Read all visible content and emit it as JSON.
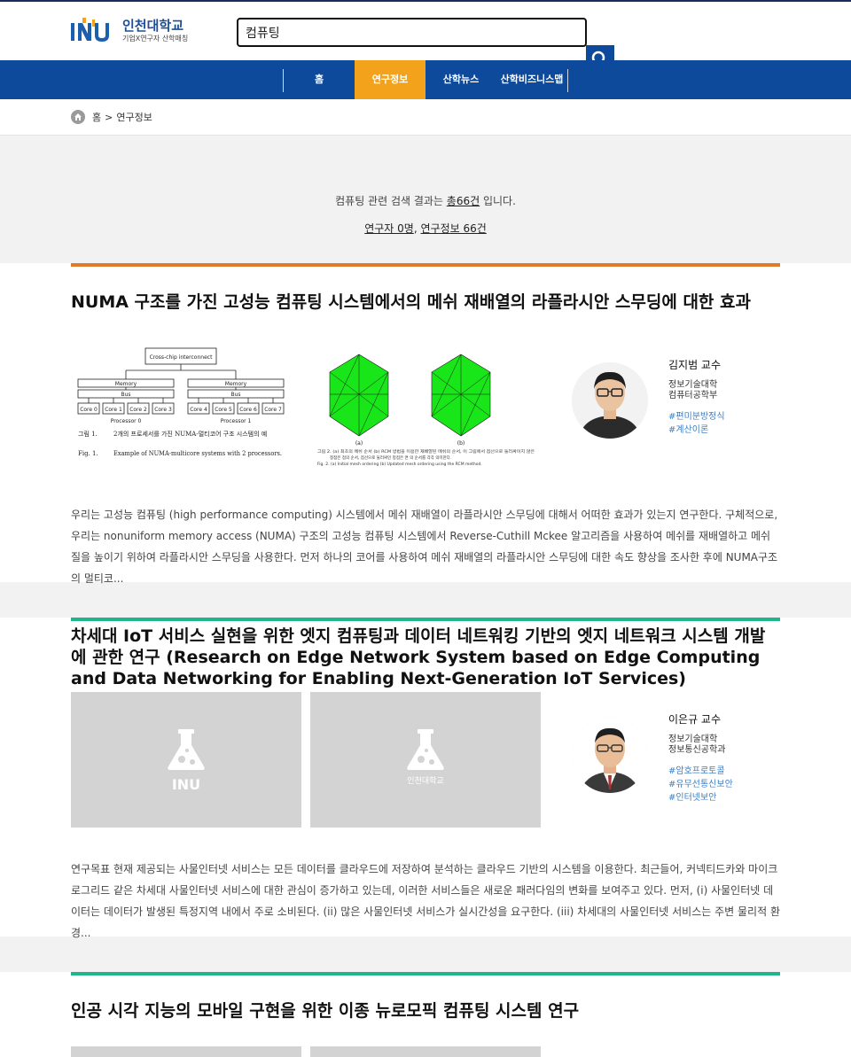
{
  "header": {
    "logo_mark": "INU",
    "logo_title": "인천대학교",
    "logo_sub": "기업X연구자 산학매칭",
    "search_value": "컴퓨팅"
  },
  "nav": {
    "items": [
      {
        "label": "홈",
        "active": false
      },
      {
        "label": "연구정보",
        "active": true
      },
      {
        "label": "산학뉴스",
        "active": false
      },
      {
        "label": "산학비즈니스맵",
        "active": false
      }
    ]
  },
  "breadcrumb": {
    "home": "홈",
    "sep": ">",
    "current": "연구정보"
  },
  "summary": {
    "prefix": "컴퓨팅 관련 검색 결과는 ",
    "total": "총66건",
    "suffix": " 입니다.",
    "researchers": "연구자 0명",
    "comma": ", ",
    "research": "연구정보 66건"
  },
  "results": [
    {
      "title": "NUMA 구조를 가진 고성능 컴퓨팅 시스템에서의 메쉬 재배열의 라플라시안 스무딩에 대한 효과",
      "line_color": "#e07b2a",
      "professor": "김지범 교수",
      "college": "정보기술대학",
      "department": "컴퓨터공학부",
      "tags": [
        "#편미분방정식",
        "#계산이론"
      ],
      "abstract": "우리는 고성능 컴퓨팅 (high performance computing) 시스템에서 메쉬 재배열이 라플라시안 스무딩에 대해서 어떠한 효과가 있는지 연구한다. 구체적으로, 우리는 nonuniform memory access (NUMA) 구조의 고성능 컴퓨팅 시스템에서 Reverse-Cuthill Mckee 알고리즘을 사용하여 메쉬를 재배열하고 메쉬질을 높이기 위하여 라플라시안 스무딩을 사용한다. 먼저 하나의 코어를 사용하여 메쉬 재배열의 라플라시안 스무딩에 대한 속도 향상을 조사한 후에 NUMA구조의 멀티코...",
      "figure1": {
        "interconnect": "Cross-chip interconnect",
        "memory": "Memory",
        "bus": "Bus",
        "cores": [
          "Core 0",
          "Core 1",
          "Core 2",
          "Core 3",
          "Core 4",
          "Core 5",
          "Core 6",
          "Core 7"
        ],
        "processor0": "Processor 0",
        "processor1": "Processor 1",
        "caption_ko_label": "그림  1.",
        "caption_ko": "2개의 프로세서를 가진 NUMA-멀티코어 구조 시스템의 예",
        "caption_en_label": "Fig.  1.",
        "caption_en": "Example of NUMA-multicore systems with 2 processors."
      },
      "figure2": {
        "label_a": "(a)",
        "label_b": "(b)",
        "caption1": "그림 2. (a) 최초의 메쉬 순서 (b) RCM 방법을 이용한 재배열된 메쉬의 순서, 이 그림에서 점선으로 둘러싸이지 않은",
        "caption2": "정점은 점의 순서, 점선으로 둘러싸인 정점은 면 의 순서를 각각 의미한다.",
        "caption3": "Fig. 2. (a) Initial mesh ordering (b) Updated mesh ordering using the RCM method."
      }
    },
    {
      "title": "차세대 IoT 서비스 실현을 위한 엣지 컴퓨팅과 데이터 네트워킹 기반의 엣지 네트워크 시스템 개발에 관한 연구 (Research on Edge Network System based on Edge Computing and Data Networking for Enabling Next-Generation IoT Services)",
      "line_color": "#1db58c",
      "professor": "이은규 교수",
      "college": "정보기술대학",
      "department": "정보통신공학과",
      "tags": [
        "#암호프로토콜",
        "#유무선통신보안",
        "#인터넷보안"
      ],
      "abstract": "연구목표 현재 제공되는 사물인터넷 서비스는 모든 데이터를 클라우드에 저장하여 분석하는 클라우드 기반의 시스템을 이용한다. 최근들어, 커넥티드카와 마이크로그리드 같은 차세대 사물인터넷 서비스에 대한 관심이 증가하고 있는데, 이러한 서비스들은 새로운 패러다임의 변화를 보여주고 있다. 먼저, (i) 사물인터넷 데이터는 데이터가 발생된 특정지역 내에서 주로 소비된다. (ii) 많은 사물인터넷 서비스가 실시간성을 요구한다. (iii) 차세대의 사물인터넷 서비스는 주변 물리적 환경...",
      "placeholder1_text": "INU",
      "placeholder2_text": "인천대학교"
    },
    {
      "title": "인공 시각 지능의 모바일 구현을 위한 이종 뉴로모픽 컴퓨팅 시스템 연구",
      "line_color": "#1db58c"
    }
  ]
}
